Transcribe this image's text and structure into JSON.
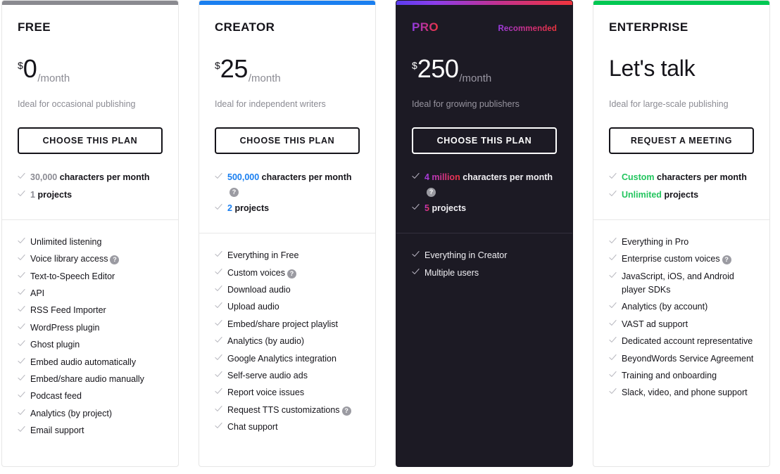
{
  "accent_colors": {
    "free": "#8a8a90",
    "creator": "#1a7ff0",
    "pro_gradient_start": "#5b3df0",
    "pro_gradient_mid": "#c2318f",
    "pro_gradient_end": "#f0343c",
    "enterprise": "#00c853"
  },
  "plans": [
    {
      "name": "FREE",
      "badge": "",
      "currency": "$",
      "amount": "0",
      "period": "/month",
      "tagline": "Ideal for occasional publishing",
      "cta": "CHOOSE THIS PLAN",
      "quota": [
        {
          "highlight": "30,000",
          "rest": "characters per month",
          "help": false
        },
        {
          "highlight": "1",
          "rest": "projects",
          "help": false
        }
      ],
      "features": [
        {
          "label": "Unlimited listening",
          "help": false
        },
        {
          "label": "Voice library access",
          "help": true
        },
        {
          "label": "Text-to-Speech Editor",
          "help": false
        },
        {
          "label": "API",
          "help": false
        },
        {
          "label": "RSS Feed Importer",
          "help": false
        },
        {
          "label": "WordPress plugin",
          "help": false
        },
        {
          "label": "Ghost plugin",
          "help": false
        },
        {
          "label": "Embed audio automatically",
          "help": false
        },
        {
          "label": "Embed/share audio manually",
          "help": false
        },
        {
          "label": "Podcast feed",
          "help": false
        },
        {
          "label": "Analytics (by project)",
          "help": false
        },
        {
          "label": "Email support",
          "help": false
        }
      ]
    },
    {
      "name": "CREATOR",
      "badge": "",
      "currency": "$",
      "amount": "25",
      "period": "/month",
      "tagline": "Ideal for independent writers",
      "cta": "CHOOSE THIS PLAN",
      "quota": [
        {
          "highlight": "500,000",
          "rest": "characters per month",
          "help": true
        },
        {
          "highlight": "2",
          "rest": "projects",
          "help": false
        }
      ],
      "features": [
        {
          "label": "Everything in Free",
          "help": false
        },
        {
          "label": "Custom voices",
          "help": true
        },
        {
          "label": "Download audio",
          "help": false
        },
        {
          "label": "Upload audio",
          "help": false
        },
        {
          "label": "Embed/share project playlist",
          "help": false
        },
        {
          "label": "Analytics (by audio)",
          "help": false
        },
        {
          "label": "Google Analytics integration",
          "help": false
        },
        {
          "label": "Self-serve audio ads",
          "help": false
        },
        {
          "label": "Report voice issues",
          "help": false
        },
        {
          "label": "Request TTS customizations",
          "help": true
        },
        {
          "label": "Chat support",
          "help": false
        }
      ]
    },
    {
      "name": "PRO",
      "badge": "Recommended",
      "currency": "$",
      "amount": "250",
      "period": "/month",
      "tagline": "Ideal for growing publishers",
      "cta": "CHOOSE THIS PLAN",
      "quota": [
        {
          "highlight": "4 million",
          "rest": "characters per month",
          "help": true
        },
        {
          "highlight": "5",
          "rest": "projects",
          "help": false
        }
      ],
      "features": [
        {
          "label": "Everything in Creator",
          "help": false
        },
        {
          "label": "Multiple users",
          "help": false
        }
      ]
    },
    {
      "name": "ENTERPRISE",
      "badge": "",
      "currency": "",
      "amount": "Let's talk",
      "period": "",
      "tagline": "Ideal for large-scale publishing",
      "cta": "REQUEST A MEETING",
      "quota": [
        {
          "highlight": "Custom",
          "rest": "characters per month",
          "help": false
        },
        {
          "highlight": "Unlimited",
          "rest": "projects",
          "help": false
        }
      ],
      "features": [
        {
          "label": "Everything in Pro",
          "help": false
        },
        {
          "label": "Enterprise custom voices",
          "help": true
        },
        {
          "label": "JavaScript, iOS, and Android player SDKs",
          "help": false
        },
        {
          "label": "Analytics (by account)",
          "help": false
        },
        {
          "label": "VAST ad support",
          "help": false
        },
        {
          "label": "Dedicated account representative",
          "help": false
        },
        {
          "label": "BeyondWords Service Agreement",
          "help": false
        },
        {
          "label": "Training and onboarding",
          "help": false
        },
        {
          "label": "Slack, video, and phone support",
          "help": false
        }
      ]
    }
  ],
  "icons": {
    "check": "check-icon",
    "help": "?"
  }
}
